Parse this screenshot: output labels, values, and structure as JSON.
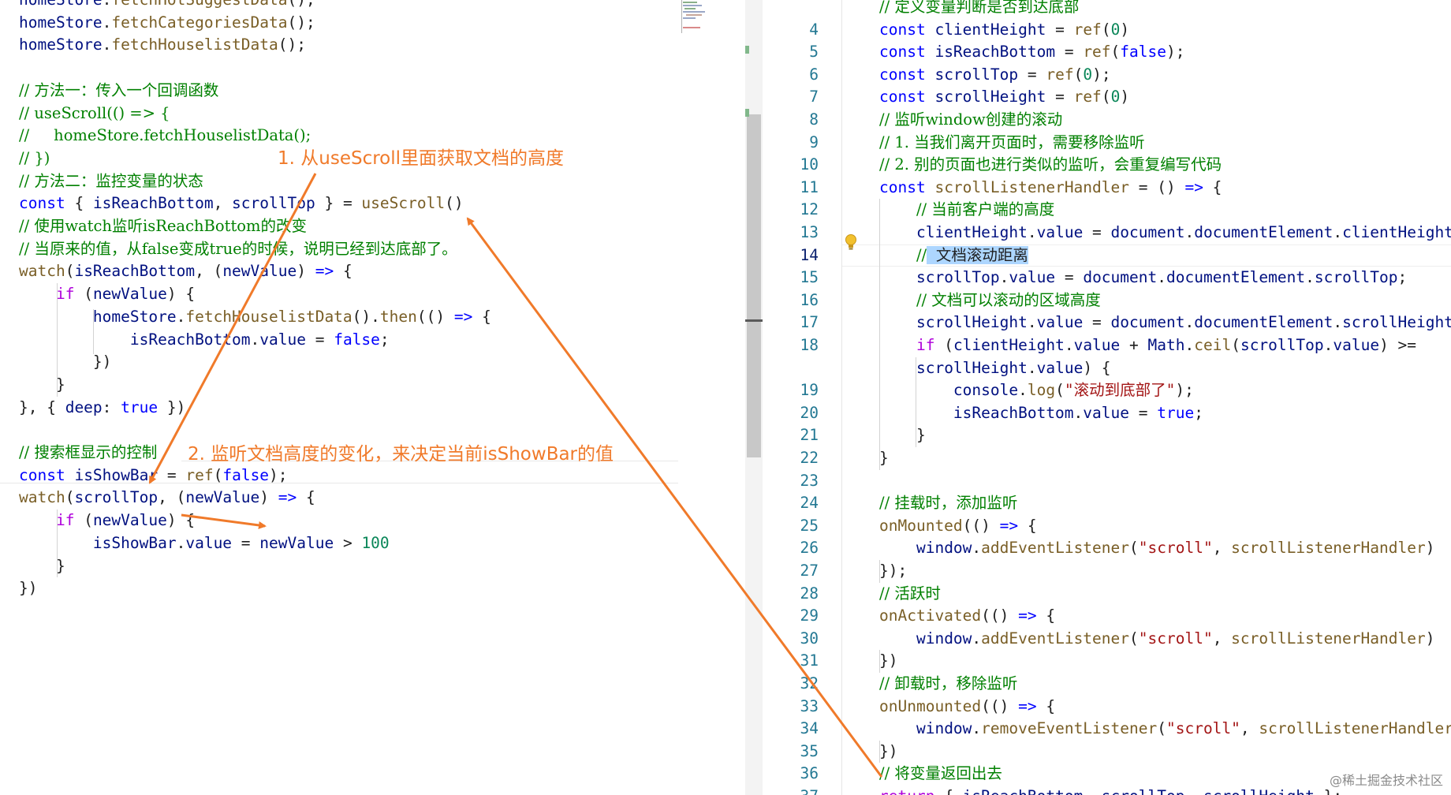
{
  "left_editor": {
    "lines": [
      [
        [
          "homeStore",
          "id"
        ],
        [
          ".",
          "pl"
        ],
        [
          "fetchHotSuggestData",
          "fn"
        ],
        [
          "();",
          "pl"
        ]
      ],
      [
        [
          "homeStore",
          "id"
        ],
        [
          ".",
          "pl"
        ],
        [
          "fetchCategoriesData",
          "fn"
        ],
        [
          "();",
          "pl"
        ]
      ],
      [
        [
          "homeStore",
          "id"
        ],
        [
          ".",
          "pl"
        ],
        [
          "fetchHouselistData",
          "fn"
        ],
        [
          "();",
          "pl"
        ]
      ],
      [],
      [
        [
          "// 方法一：传入一个回调函数",
          "cm"
        ]
      ],
      [
        [
          "// useScroll(() => {",
          "cm"
        ]
      ],
      [
        [
          "//     homeStore.fetchHouselistData();",
          "cm"
        ]
      ],
      [
        [
          "// })",
          "cm"
        ]
      ],
      [
        [
          "// 方法二：监控变量的状态",
          "cm"
        ]
      ],
      [
        [
          "const",
          "kw"
        ],
        [
          " { ",
          "pl"
        ],
        [
          "isReachBottom",
          "id"
        ],
        [
          ", ",
          "pl"
        ],
        [
          "scrollTop",
          "id"
        ],
        [
          " } = ",
          "pl"
        ],
        [
          "useScroll",
          "fn"
        ],
        [
          "()",
          "pl"
        ]
      ],
      [
        [
          "// 使用watch监听isReachBottom的改变",
          "cm"
        ]
      ],
      [
        [
          "// 当原来的值，从false变成true的时候，说明已经到达底部了。",
          "cm"
        ]
      ],
      [
        [
          "watch",
          "fn"
        ],
        [
          "(",
          "pl"
        ],
        [
          "isReachBottom",
          "id"
        ],
        [
          ", (",
          "pl"
        ],
        [
          "newValue",
          "id"
        ],
        [
          ") ",
          "pl"
        ],
        [
          "=>",
          "kw"
        ],
        [
          " {",
          "pl"
        ]
      ],
      [
        [
          "    ",
          "pl"
        ],
        [
          "if",
          "ctl"
        ],
        [
          " (",
          "pl"
        ],
        [
          "newValue",
          "id"
        ],
        [
          ") {",
          "pl"
        ]
      ],
      [
        [
          "        ",
          "pl"
        ],
        [
          "homeStore",
          "id"
        ],
        [
          ".",
          "pl"
        ],
        [
          "fetchHouselistData",
          "fn"
        ],
        [
          "().",
          "pl"
        ],
        [
          "then",
          "fn"
        ],
        [
          "(() ",
          "pl"
        ],
        [
          "=>",
          "kw"
        ],
        [
          " {",
          "pl"
        ]
      ],
      [
        [
          "            ",
          "pl"
        ],
        [
          "isReachBottom",
          "id"
        ],
        [
          ".",
          "pl"
        ],
        [
          "value",
          "id"
        ],
        [
          " = ",
          "pl"
        ],
        [
          "false",
          "kw"
        ],
        [
          ";",
          "pl"
        ]
      ],
      [
        [
          "        })",
          "pl"
        ]
      ],
      [
        [
          "    }",
          "pl"
        ]
      ],
      [
        [
          "}, { ",
          "pl"
        ],
        [
          "deep",
          "id"
        ],
        [
          ": ",
          "pl"
        ],
        [
          "true",
          "kw"
        ],
        [
          " })",
          "pl"
        ]
      ],
      [],
      [
        [
          "// 搜索框显示的控制",
          "cm"
        ]
      ],
      [
        [
          "const",
          "kw"
        ],
        [
          " ",
          "pl"
        ],
        [
          "isShowBar",
          "id"
        ],
        [
          " = ",
          "pl"
        ],
        [
          "ref",
          "fn"
        ],
        [
          "(",
          "pl"
        ],
        [
          "false",
          "kw"
        ],
        [
          ");",
          "pl"
        ]
      ],
      [
        [
          "watch",
          "fn"
        ],
        [
          "(",
          "pl"
        ],
        [
          "scrollTop",
          "id"
        ],
        [
          ", (",
          "pl"
        ],
        [
          "newValue",
          "id"
        ],
        [
          ") ",
          "pl"
        ],
        [
          "=>",
          "kw"
        ],
        [
          " {",
          "pl"
        ]
      ],
      [
        [
          "    ",
          "pl"
        ],
        [
          "if",
          "ctl"
        ],
        [
          " (",
          "pl"
        ],
        [
          "newValue",
          "id"
        ],
        [
          ") {",
          "pl"
        ]
      ],
      [
        [
          "        ",
          "pl"
        ],
        [
          "isShowBar",
          "id"
        ],
        [
          ".",
          "pl"
        ],
        [
          "value",
          "id"
        ],
        [
          " = ",
          "pl"
        ],
        [
          "newValue",
          "id"
        ],
        [
          " > ",
          "pl"
        ],
        [
          "100",
          "num"
        ]
      ],
      [
        [
          "    }",
          "pl"
        ]
      ],
      [
        [
          "})",
          "pl"
        ]
      ]
    ]
  },
  "right_editor": {
    "active_line": "14",
    "lines": [
      {
        "n": "",
        "t": [
          [
            "// 定义变量判断是否到达底部",
            "cm"
          ]
        ]
      },
      {
        "n": "4",
        "t": [
          [
            "const",
            "kw"
          ],
          [
            " ",
            "pl"
          ],
          [
            "clientHeight",
            "id"
          ],
          [
            " = ",
            "pl"
          ],
          [
            "ref",
            "fn"
          ],
          [
            "(",
            "pl"
          ],
          [
            "0",
            "num"
          ],
          [
            ")",
            "pl"
          ]
        ]
      },
      {
        "n": "5",
        "t": [
          [
            "const",
            "kw"
          ],
          [
            " ",
            "pl"
          ],
          [
            "isReachBottom",
            "id"
          ],
          [
            " = ",
            "pl"
          ],
          [
            "ref",
            "fn"
          ],
          [
            "(",
            "pl"
          ],
          [
            "false",
            "kw"
          ],
          [
            ");",
            "pl"
          ]
        ]
      },
      {
        "n": "6",
        "t": [
          [
            "const",
            "kw"
          ],
          [
            " ",
            "pl"
          ],
          [
            "scrollTop",
            "id"
          ],
          [
            " = ",
            "pl"
          ],
          [
            "ref",
            "fn"
          ],
          [
            "(",
            "pl"
          ],
          [
            "0",
            "num"
          ],
          [
            ");",
            "pl"
          ]
        ]
      },
      {
        "n": "7",
        "t": [
          [
            "const",
            "kw"
          ],
          [
            " ",
            "pl"
          ],
          [
            "scrollHeight",
            "id"
          ],
          [
            " = ",
            "pl"
          ],
          [
            "ref",
            "fn"
          ],
          [
            "(",
            "pl"
          ],
          [
            "0",
            "num"
          ],
          [
            ")",
            "pl"
          ]
        ]
      },
      {
        "n": "8",
        "t": [
          [
            "// 监听window创建的滚动",
            "cm"
          ]
        ]
      },
      {
        "n": "9",
        "t": [
          [
            "// 1. 当我们离开页面时，需要移除监听",
            "cm"
          ]
        ]
      },
      {
        "n": "10",
        "t": [
          [
            "// 2. 别的页面也进行类似的监听，会重复编写代码",
            "cm"
          ]
        ]
      },
      {
        "n": "11",
        "t": [
          [
            "const",
            "kw"
          ],
          [
            " ",
            "pl"
          ],
          [
            "scrollListenerHandler",
            "fn"
          ],
          [
            " = () ",
            "pl"
          ],
          [
            "=>",
            "kw"
          ],
          [
            " {",
            "pl"
          ]
        ]
      },
      {
        "n": "12",
        "t": [
          [
            "    ",
            "pl"
          ],
          [
            "// 当前客户端的高度",
            "cm"
          ]
        ]
      },
      {
        "n": "13",
        "t": [
          [
            "    ",
            "pl"
          ],
          [
            "clientHeight",
            "id"
          ],
          [
            ".",
            "pl"
          ],
          [
            "value",
            "id"
          ],
          [
            " = ",
            "pl"
          ],
          [
            "document",
            "id"
          ],
          [
            ".",
            "pl"
          ],
          [
            "documentElement",
            "id"
          ],
          [
            ".",
            "pl"
          ],
          [
            "clientHeight",
            "id"
          ],
          [
            ";",
            "pl"
          ]
        ]
      },
      {
        "n": "14",
        "t": [
          [
            "    ",
            "pl"
          ],
          [
            "//",
            "cm"
          ],
          [
            " 文档滚动距离",
            "hl"
          ]
        ]
      },
      {
        "n": "15",
        "t": [
          [
            "    ",
            "pl"
          ],
          [
            "scrollTop",
            "id"
          ],
          [
            ".",
            "pl"
          ],
          [
            "value",
            "id"
          ],
          [
            " = ",
            "pl"
          ],
          [
            "document",
            "id"
          ],
          [
            ".",
            "pl"
          ],
          [
            "documentElement",
            "id"
          ],
          [
            ".",
            "pl"
          ],
          [
            "scrollTop",
            "id"
          ],
          [
            ";",
            "pl"
          ]
        ]
      },
      {
        "n": "16",
        "t": [
          [
            "    ",
            "pl"
          ],
          [
            "// 文档可以滚动的区域高度",
            "cm"
          ]
        ]
      },
      {
        "n": "17",
        "t": [
          [
            "    ",
            "pl"
          ],
          [
            "scrollHeight",
            "id"
          ],
          [
            ".",
            "pl"
          ],
          [
            "value",
            "id"
          ],
          [
            " = ",
            "pl"
          ],
          [
            "document",
            "id"
          ],
          [
            ".",
            "pl"
          ],
          [
            "documentElement",
            "id"
          ],
          [
            ".",
            "pl"
          ],
          [
            "scrollHeight",
            "id"
          ],
          [
            ";",
            "pl"
          ]
        ]
      },
      {
        "n": "18",
        "t": [
          [
            "    ",
            "pl"
          ],
          [
            "if",
            "ctl"
          ],
          [
            " (",
            "pl"
          ],
          [
            "clientHeight",
            "id"
          ],
          [
            ".",
            "pl"
          ],
          [
            "value",
            "id"
          ],
          [
            " + ",
            "pl"
          ],
          [
            "Math",
            "id"
          ],
          [
            ".",
            "pl"
          ],
          [
            "ceil",
            "fn"
          ],
          [
            "(",
            "pl"
          ],
          [
            "scrollTop",
            "id"
          ],
          [
            ".",
            "pl"
          ],
          [
            "value",
            "id"
          ],
          [
            ") >=",
            "pl"
          ]
        ]
      },
      {
        "n": "",
        "t": [
          [
            "    ",
            "pl"
          ],
          [
            "scrollHeight",
            "id"
          ],
          [
            ".",
            "pl"
          ],
          [
            "value",
            "id"
          ],
          [
            ") {",
            "pl"
          ]
        ]
      },
      {
        "n": "19",
        "t": [
          [
            "        ",
            "pl"
          ],
          [
            "console",
            "id"
          ],
          [
            ".",
            "pl"
          ],
          [
            "log",
            "fn"
          ],
          [
            "(",
            "pl"
          ],
          [
            "\"滚动到底部了\"",
            "str"
          ],
          [
            ");",
            "pl"
          ]
        ]
      },
      {
        "n": "20",
        "t": [
          [
            "        ",
            "pl"
          ],
          [
            "isReachBottom",
            "id"
          ],
          [
            ".",
            "pl"
          ],
          [
            "value",
            "id"
          ],
          [
            " = ",
            "pl"
          ],
          [
            "true",
            "kw"
          ],
          [
            ";",
            "pl"
          ]
        ]
      },
      {
        "n": "21",
        "t": [
          [
            "    }",
            "pl"
          ]
        ]
      },
      {
        "n": "22",
        "t": [
          [
            "}",
            "pl"
          ]
        ]
      },
      {
        "n": "23",
        "t": []
      },
      {
        "n": "24",
        "t": [
          [
            "// 挂载时，添加监听",
            "cm"
          ]
        ]
      },
      {
        "n": "25",
        "t": [
          [
            "onMounted",
            "fn"
          ],
          [
            "(() ",
            "pl"
          ],
          [
            "=>",
            "kw"
          ],
          [
            " {",
            "pl"
          ]
        ]
      },
      {
        "n": "26",
        "t": [
          [
            "    ",
            "pl"
          ],
          [
            "window",
            "id"
          ],
          [
            ".",
            "pl"
          ],
          [
            "addEventListener",
            "fn"
          ],
          [
            "(",
            "pl"
          ],
          [
            "\"scroll\"",
            "str"
          ],
          [
            ", ",
            "pl"
          ],
          [
            "scrollListenerHandler",
            "fn"
          ],
          [
            ")",
            "pl"
          ]
        ]
      },
      {
        "n": "27",
        "t": [
          [
            "});",
            "pl"
          ]
        ]
      },
      {
        "n": "28",
        "t": [
          [
            "// 活跃时",
            "cm"
          ]
        ]
      },
      {
        "n": "29",
        "t": [
          [
            "onActivated",
            "fn"
          ],
          [
            "(() ",
            "pl"
          ],
          [
            "=>",
            "kw"
          ],
          [
            " {",
            "pl"
          ]
        ]
      },
      {
        "n": "30",
        "t": [
          [
            "    ",
            "pl"
          ],
          [
            "window",
            "id"
          ],
          [
            ".",
            "pl"
          ],
          [
            "addEventListener",
            "fn"
          ],
          [
            "(",
            "pl"
          ],
          [
            "\"scroll\"",
            "str"
          ],
          [
            ", ",
            "pl"
          ],
          [
            "scrollListenerHandler",
            "fn"
          ],
          [
            ")",
            "pl"
          ]
        ]
      },
      {
        "n": "31",
        "t": [
          [
            "})",
            "pl"
          ]
        ]
      },
      {
        "n": "32",
        "t": [
          [
            "// 卸载时，移除监听",
            "cm"
          ]
        ]
      },
      {
        "n": "33",
        "t": [
          [
            "onUnmounted",
            "fn"
          ],
          [
            "(() ",
            "pl"
          ],
          [
            "=>",
            "kw"
          ],
          [
            " {",
            "pl"
          ]
        ]
      },
      {
        "n": "34",
        "t": [
          [
            "    ",
            "pl"
          ],
          [
            "window",
            "id"
          ],
          [
            ".",
            "pl"
          ],
          [
            "removeEventListener",
            "fn"
          ],
          [
            "(",
            "pl"
          ],
          [
            "\"scroll\"",
            "str"
          ],
          [
            ", ",
            "pl"
          ],
          [
            "scrollListenerHandler",
            "fn"
          ],
          [
            ")",
            "pl"
          ]
        ]
      },
      {
        "n": "35",
        "t": [
          [
            "})",
            "pl"
          ]
        ]
      },
      {
        "n": "36",
        "t": [
          [
            "// 将变量返回出去",
            "cm"
          ]
        ]
      },
      {
        "n": "37",
        "t": [
          [
            "return",
            "ctl"
          ],
          [
            " { ",
            "pl"
          ],
          [
            "isReachBottom",
            "id"
          ],
          [
            ", ",
            "pl"
          ],
          [
            "scrollTop",
            "id"
          ],
          [
            ", ",
            "pl"
          ],
          [
            "scrollHeight",
            "id"
          ],
          [
            " };",
            "pl"
          ]
        ]
      }
    ]
  },
  "annotations": {
    "note_1": "1. 从useScroll里面获取文档的高度",
    "note_2": "2. 监听文档高度的变化，来决定当前isShowBar的值"
  },
  "watermark": "@稀土掘金技术社区",
  "colors": {
    "annotation": "#f07a2a",
    "keyword": "#0000ff",
    "control": "#af00db",
    "function": "#795e26",
    "identifier": "#001080",
    "string": "#a31515",
    "number": "#098658",
    "comment": "#008000",
    "selection_highlight": "#add6ff",
    "line_number": "#237893"
  },
  "icons": [
    "lightbulb-icon"
  ]
}
